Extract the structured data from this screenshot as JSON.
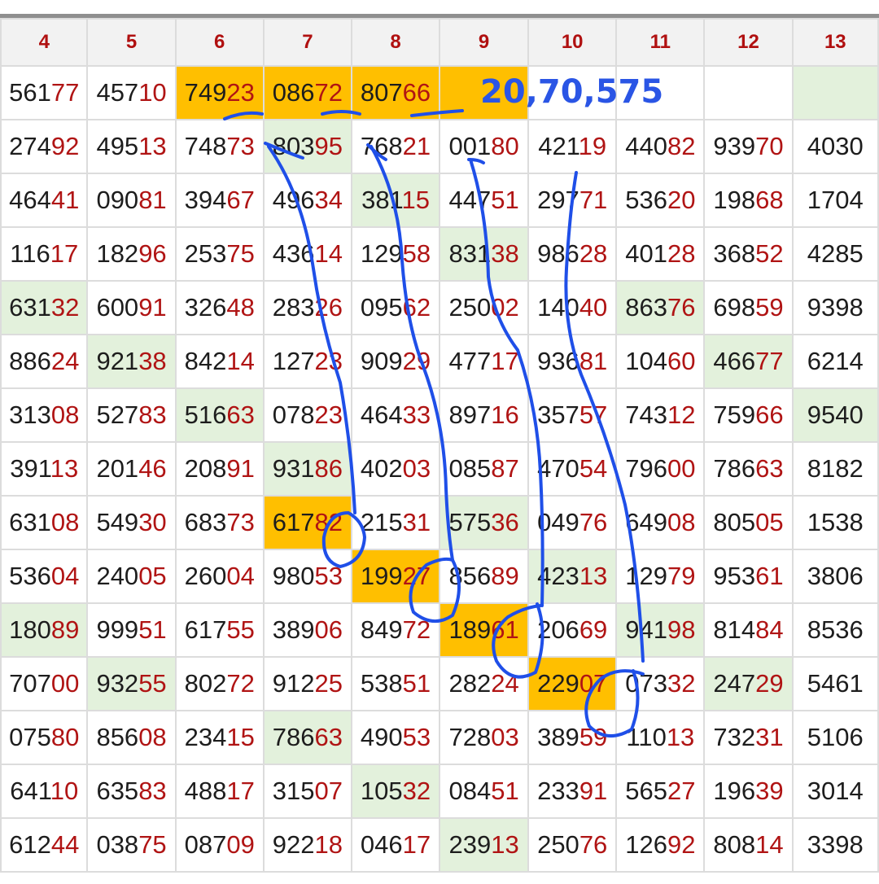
{
  "columns": [
    "4",
    "5",
    "6",
    "7",
    "8",
    "9",
    "10",
    "11",
    "12",
    "13"
  ],
  "annotation_total": "20,70,575",
  "rows": [
    [
      [
        "56177",
        ""
      ],
      [
        "45710",
        ""
      ],
      [
        "74923",
        "orange"
      ],
      [
        "08672",
        "orange"
      ],
      [
        "80766",
        "orange"
      ],
      [
        "",
        "orange"
      ],
      [
        "",
        "blank"
      ],
      [
        "",
        "blank"
      ],
      [
        "",
        "blank"
      ],
      [
        "",
        "greenblank"
      ]
    ],
    [
      [
        "27492",
        ""
      ],
      [
        "49513",
        ""
      ],
      [
        "74873",
        ""
      ],
      [
        "80395",
        "green"
      ],
      [
        "76821",
        ""
      ],
      [
        "00180",
        ""
      ],
      [
        "42119",
        ""
      ],
      [
        "44082",
        ""
      ],
      [
        "93970",
        ""
      ],
      [
        "4030",
        ""
      ]
    ],
    [
      [
        "46441",
        ""
      ],
      [
        "09081",
        ""
      ],
      [
        "39467",
        ""
      ],
      [
        "49634",
        ""
      ],
      [
        "38115",
        "green"
      ],
      [
        "44751",
        ""
      ],
      [
        "29771",
        ""
      ],
      [
        "53620",
        ""
      ],
      [
        "19868",
        ""
      ],
      [
        "1704",
        ""
      ]
    ],
    [
      [
        "11617",
        ""
      ],
      [
        "18296",
        ""
      ],
      [
        "25375",
        ""
      ],
      [
        "43614",
        ""
      ],
      [
        "12958",
        ""
      ],
      [
        "83138",
        "green"
      ],
      [
        "98628",
        ""
      ],
      [
        "40128",
        ""
      ],
      [
        "36852",
        ""
      ],
      [
        "4285",
        ""
      ]
    ],
    [
      [
        "63132",
        "green"
      ],
      [
        "60091",
        ""
      ],
      [
        "32648",
        ""
      ],
      [
        "28326",
        ""
      ],
      [
        "09562",
        ""
      ],
      [
        "25002",
        ""
      ],
      [
        "14040",
        ""
      ],
      [
        "86376",
        "green"
      ],
      [
        "69859",
        ""
      ],
      [
        "9398",
        ""
      ]
    ],
    [
      [
        "88624",
        ""
      ],
      [
        "92138",
        "green"
      ],
      [
        "84214",
        ""
      ],
      [
        "12723",
        ""
      ],
      [
        "90929",
        ""
      ],
      [
        "47717",
        ""
      ],
      [
        "93681",
        ""
      ],
      [
        "10460",
        ""
      ],
      [
        "46677",
        "green"
      ],
      [
        "6214",
        ""
      ]
    ],
    [
      [
        "31308",
        ""
      ],
      [
        "52783",
        ""
      ],
      [
        "51663",
        "green"
      ],
      [
        "07823",
        ""
      ],
      [
        "46433",
        ""
      ],
      [
        "89716",
        ""
      ],
      [
        "35757",
        ""
      ],
      [
        "74312",
        ""
      ],
      [
        "75966",
        ""
      ],
      [
        "9540",
        "green"
      ]
    ],
    [
      [
        "39113",
        ""
      ],
      [
        "20146",
        ""
      ],
      [
        "20891",
        ""
      ],
      [
        "93186",
        "green"
      ],
      [
        "40203",
        ""
      ],
      [
        "08587",
        ""
      ],
      [
        "47054",
        ""
      ],
      [
        "79600",
        ""
      ],
      [
        "78663",
        ""
      ],
      [
        "8182",
        ""
      ]
    ],
    [
      [
        "63108",
        ""
      ],
      [
        "54930",
        ""
      ],
      [
        "68373",
        ""
      ],
      [
        "61782",
        "orange"
      ],
      [
        "21531",
        ""
      ],
      [
        "57536",
        "green"
      ],
      [
        "04976",
        ""
      ],
      [
        "64908",
        ""
      ],
      [
        "80505",
        ""
      ],
      [
        "1538",
        ""
      ]
    ],
    [
      [
        "53604",
        ""
      ],
      [
        "24005",
        ""
      ],
      [
        "26004",
        ""
      ],
      [
        "98053",
        ""
      ],
      [
        "19927",
        "orange"
      ],
      [
        "85689",
        ""
      ],
      [
        "42313",
        "green"
      ],
      [
        "12979",
        ""
      ],
      [
        "95361",
        ""
      ],
      [
        "3806",
        ""
      ]
    ],
    [
      [
        "18089",
        "green"
      ],
      [
        "99951",
        ""
      ],
      [
        "61755",
        ""
      ],
      [
        "38906",
        ""
      ],
      [
        "84972",
        ""
      ],
      [
        "18961",
        "orange"
      ],
      [
        "20669",
        ""
      ],
      [
        "94198",
        "green"
      ],
      [
        "81484",
        ""
      ],
      [
        "8536",
        ""
      ]
    ],
    [
      [
        "70700",
        ""
      ],
      [
        "93255",
        "green"
      ],
      [
        "80272",
        ""
      ],
      [
        "91225",
        ""
      ],
      [
        "53851",
        ""
      ],
      [
        "28224",
        ""
      ],
      [
        "22907",
        "orange"
      ],
      [
        "07332",
        ""
      ],
      [
        "24729",
        "green"
      ],
      [
        "5461",
        ""
      ]
    ],
    [
      [
        "07580",
        ""
      ],
      [
        "85608",
        ""
      ],
      [
        "23415",
        ""
      ],
      [
        "78663",
        "green"
      ],
      [
        "49053",
        ""
      ],
      [
        "72803",
        ""
      ],
      [
        "38959",
        ""
      ],
      [
        "11013",
        ""
      ],
      [
        "73231",
        ""
      ],
      [
        "5106",
        ""
      ]
    ],
    [
      [
        "64110",
        ""
      ],
      [
        "63583",
        ""
      ],
      [
        "48817",
        ""
      ],
      [
        "31507",
        ""
      ],
      [
        "10532",
        "green"
      ],
      [
        "08451",
        ""
      ],
      [
        "23391",
        ""
      ],
      [
        "56527",
        ""
      ],
      [
        "19639",
        ""
      ],
      [
        "3014",
        ""
      ]
    ],
    [
      [
        "61244",
        ""
      ],
      [
        "03875",
        ""
      ],
      [
        "08709",
        ""
      ],
      [
        "92218",
        ""
      ],
      [
        "04617",
        ""
      ],
      [
        "23913",
        "green"
      ],
      [
        "25076",
        ""
      ],
      [
        "12692",
        ""
      ],
      [
        "80814",
        ""
      ],
      [
        "3398",
        ""
      ]
    ]
  ]
}
